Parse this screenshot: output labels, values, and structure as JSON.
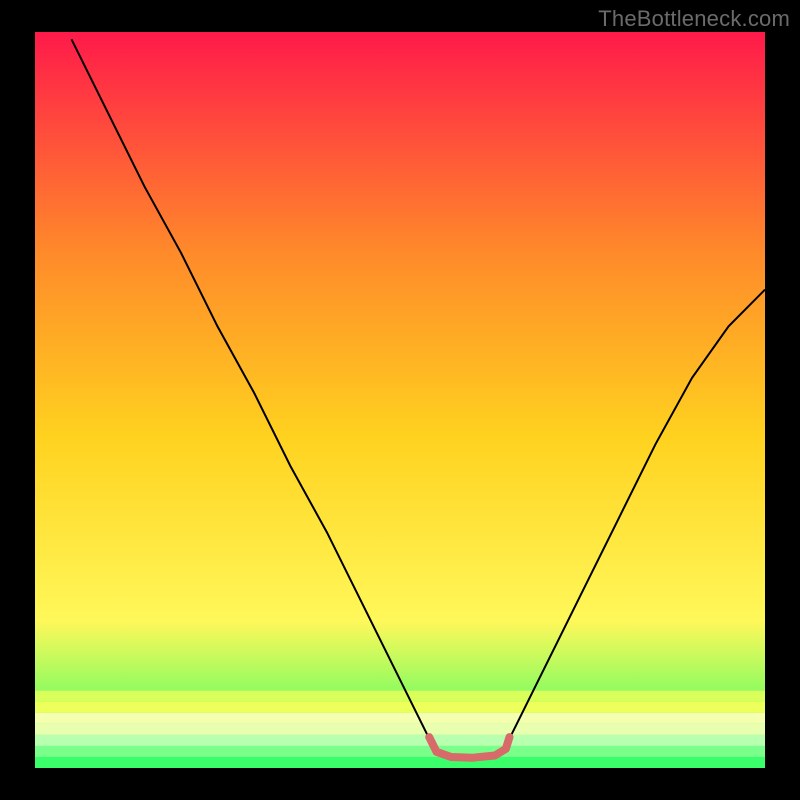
{
  "watermark": "TheBottleneck.com",
  "chart_data": {
    "type": "line",
    "title": "",
    "xlabel": "",
    "ylabel": "",
    "xlim": [
      0,
      100
    ],
    "ylim": [
      0,
      100
    ],
    "background_gradient": {
      "top": "#ff1a4a",
      "upper_mid": "#ff8a2a",
      "mid": "#ffd21f",
      "lower_mid": "#fff85a",
      "bottom": "#1aff66"
    },
    "series": [
      {
        "name": "curve-left",
        "stroke": "#000000",
        "points": [
          {
            "x": 5,
            "y": 99
          },
          {
            "x": 10,
            "y": 89
          },
          {
            "x": 15,
            "y": 79
          },
          {
            "x": 20,
            "y": 70
          },
          {
            "x": 25,
            "y": 60
          },
          {
            "x": 30,
            "y": 51
          },
          {
            "x": 35,
            "y": 41
          },
          {
            "x": 40,
            "y": 32
          },
          {
            "x": 45,
            "y": 22
          },
          {
            "x": 50,
            "y": 12
          },
          {
            "x": 54,
            "y": 4
          }
        ]
      },
      {
        "name": "curve-right",
        "stroke": "#000000",
        "points": [
          {
            "x": 65,
            "y": 4
          },
          {
            "x": 70,
            "y": 14
          },
          {
            "x": 75,
            "y": 24
          },
          {
            "x": 80,
            "y": 34
          },
          {
            "x": 85,
            "y": 44
          },
          {
            "x": 90,
            "y": 53
          },
          {
            "x": 95,
            "y": 60
          },
          {
            "x": 100,
            "y": 65
          }
        ]
      },
      {
        "name": "valley-marker",
        "stroke": "#d86a6a",
        "stroke_width": 8,
        "points": [
          {
            "x": 54,
            "y": 4.2
          },
          {
            "x": 55,
            "y": 2.2
          },
          {
            "x": 57,
            "y": 1.5
          },
          {
            "x": 60,
            "y": 1.4
          },
          {
            "x": 63,
            "y": 1.7
          },
          {
            "x": 64.5,
            "y": 2.6
          },
          {
            "x": 65,
            "y": 4.2
          }
        ]
      }
    ],
    "bottom_bands": [
      {
        "y": 10.5,
        "color": "#d8ff5a"
      },
      {
        "y": 9.0,
        "color": "#ecff5a"
      },
      {
        "y": 7.5,
        "color": "#f5ffb0"
      },
      {
        "y": 6.0,
        "color": "#e8ffb0"
      },
      {
        "y": 4.5,
        "color": "#b8ffb0"
      },
      {
        "y": 3.0,
        "color": "#7aff8a"
      },
      {
        "y": 1.5,
        "color": "#3aff6a"
      },
      {
        "y": 0.0,
        "color": "#14cc52"
      }
    ]
  }
}
